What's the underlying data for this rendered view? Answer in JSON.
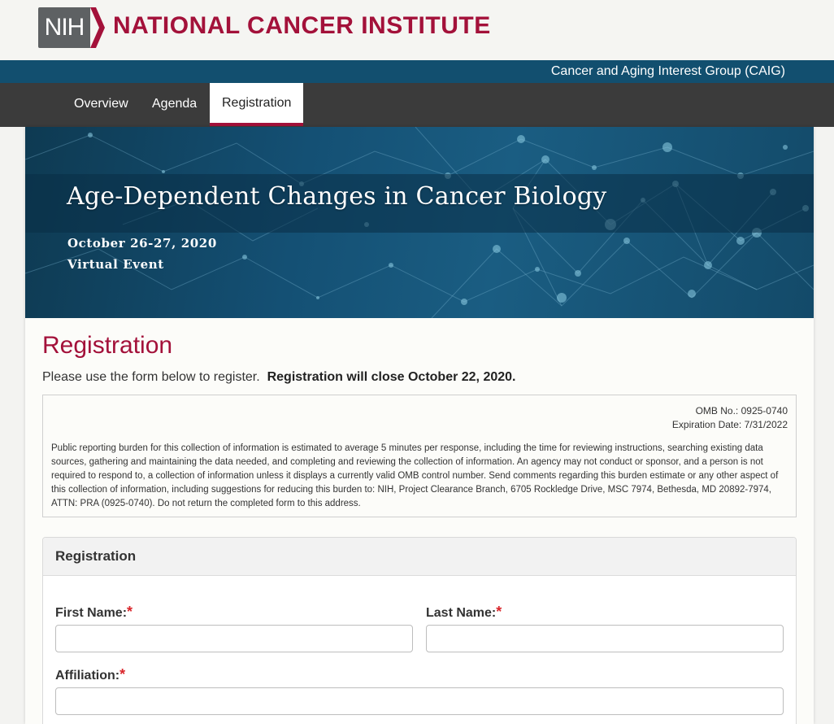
{
  "header": {
    "logo_text": "NIH",
    "institute": "NATIONAL CANCER INSTITUTE",
    "group": "Cancer and Aging Interest Group (CAIG)",
    "brand_color": "#a3113a",
    "bar_color": "#124f6f"
  },
  "nav": {
    "tabs": [
      {
        "label": "Overview",
        "active": false
      },
      {
        "label": "Agenda",
        "active": false
      },
      {
        "label": "Registration",
        "active": true
      }
    ]
  },
  "banner": {
    "title": "Age-Dependent Changes in Cancer Biology",
    "date": "October 26-27, 2020",
    "venue": "Virtual Event"
  },
  "main": {
    "title": "Registration",
    "intro": "Please use the form below to register.",
    "intro_bold": "Registration will close October 22, 2020."
  },
  "omb": {
    "number": "OMB No.: 0925-0740",
    "expiration": "Expiration Date: 7/31/2022",
    "notice": "Public reporting burden for this collection of information is estimated to average 5 minutes per response, including the time for reviewing instructions, searching existing data sources, gathering and maintaining the data needed, and completing and reviewing the collection of information. An agency may not conduct or sponsor, and a person is not required to respond to, a collection of information unless it displays a currently valid OMB control number. Send comments regarding this burden estimate or any other aspect of this collection of information, including suggestions for reducing this burden to: NIH, Project Clearance Branch, 6705 Rockledge Drive, MSC 7974, Bethesda, MD 20892-7974, ATTN: PRA (0925-0740). Do not return the completed form to this address."
  },
  "form": {
    "panel_title": "Registration",
    "required_mark": "*",
    "first_name": {
      "label": "First Name:",
      "value": ""
    },
    "last_name": {
      "label": "Last Name:",
      "value": ""
    },
    "affiliation": {
      "label": "Affiliation:",
      "value": ""
    }
  }
}
